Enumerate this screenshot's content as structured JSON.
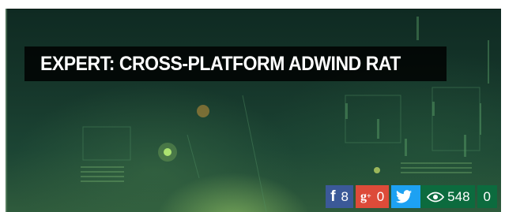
{
  "article": {
    "title": "EXPERT: CROSS-PLATFORM ADWIND RAT"
  },
  "share_bar": {
    "facebook": {
      "icon": "facebook-icon",
      "glyph": "f",
      "count": "8",
      "color": "#3b5998"
    },
    "google_plus": {
      "icon": "google-plus-icon",
      "glyph": "g+",
      "count": "0",
      "color": "#dd4b39"
    },
    "twitter": {
      "icon": "twitter-icon",
      "color": "#1da1f2"
    },
    "views": {
      "icon": "eye-icon",
      "count": "548",
      "color": "#0c6b3e"
    },
    "comments": {
      "count": "0",
      "color": "#0c6b3e"
    }
  }
}
